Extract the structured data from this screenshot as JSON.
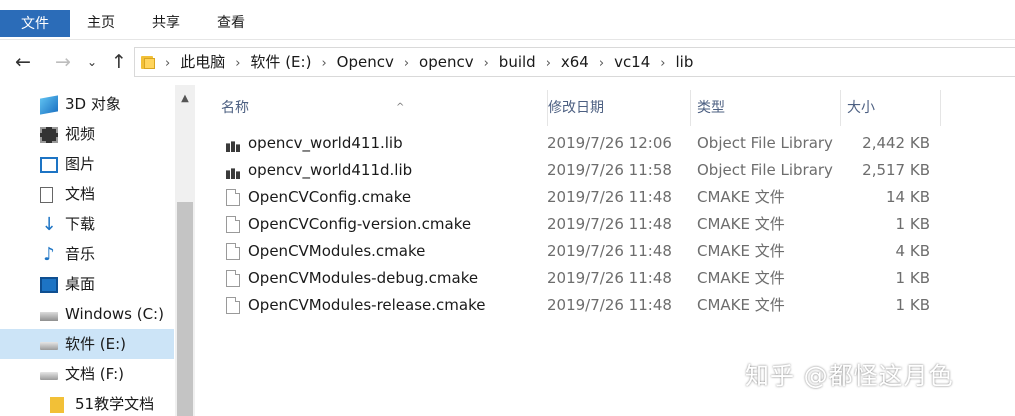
{
  "ribbon": {
    "tabs": [
      "文件",
      "主页",
      "共享",
      "查看"
    ]
  },
  "address": {
    "crumbs": [
      "此电脑",
      "软件 (E:)",
      "Opencv",
      "opencv",
      "build",
      "x64",
      "vc14",
      "lib"
    ]
  },
  "nav": {
    "items": [
      {
        "label": "3D 对象",
        "icon": "3d-objects-icon"
      },
      {
        "label": "视频",
        "icon": "video-icon"
      },
      {
        "label": "图片",
        "icon": "pictures-icon"
      },
      {
        "label": "文档",
        "icon": "documents-icon"
      },
      {
        "label": "下载",
        "icon": "download-icon"
      },
      {
        "label": "音乐",
        "icon": "music-icon"
      },
      {
        "label": "桌面",
        "icon": "desktop-icon"
      },
      {
        "label": "Windows (C:)",
        "icon": "windows-drive-icon"
      },
      {
        "label": "软件 (E:)",
        "icon": "drive-icon",
        "selected": true
      },
      {
        "label": "文档 (F:)",
        "icon": "drive-icon"
      },
      {
        "label": "51教学文档",
        "icon": "folder-icon"
      }
    ]
  },
  "columns": {
    "name": "名称",
    "date": "修改日期",
    "type": "类型",
    "size": "大小"
  },
  "files": [
    {
      "name": "opencv_world411.lib",
      "date": "2019/7/26 12:06",
      "type": "Object File Library",
      "size": "2,442 KB",
      "icon": "library-file-icon"
    },
    {
      "name": "opencv_world411d.lib",
      "date": "2019/7/26 11:58",
      "type": "Object File Library",
      "size": "2,517 KB",
      "icon": "library-file-icon"
    },
    {
      "name": "OpenCVConfig.cmake",
      "date": "2019/7/26 11:48",
      "type": "CMAKE 文件",
      "size": "14 KB",
      "icon": "file-icon"
    },
    {
      "name": "OpenCVConfig-version.cmake",
      "date": "2019/7/26 11:48",
      "type": "CMAKE 文件",
      "size": "1 KB",
      "icon": "file-icon"
    },
    {
      "name": "OpenCVModules.cmake",
      "date": "2019/7/26 11:48",
      "type": "CMAKE 文件",
      "size": "4 KB",
      "icon": "file-icon"
    },
    {
      "name": "OpenCVModules-debug.cmake",
      "date": "2019/7/26 11:48",
      "type": "CMAKE 文件",
      "size": "1 KB",
      "icon": "file-icon"
    },
    {
      "name": "OpenCVModules-release.cmake",
      "date": "2019/7/26 11:48",
      "type": "CMAKE 文件",
      "size": "1 KB",
      "icon": "file-icon"
    }
  ],
  "watermark": "知乎 @都怪这月色",
  "colors": {
    "file_tab": "#2b6cb8",
    "selected_nav": "#cce4f7",
    "header_text": "#4d6082"
  }
}
